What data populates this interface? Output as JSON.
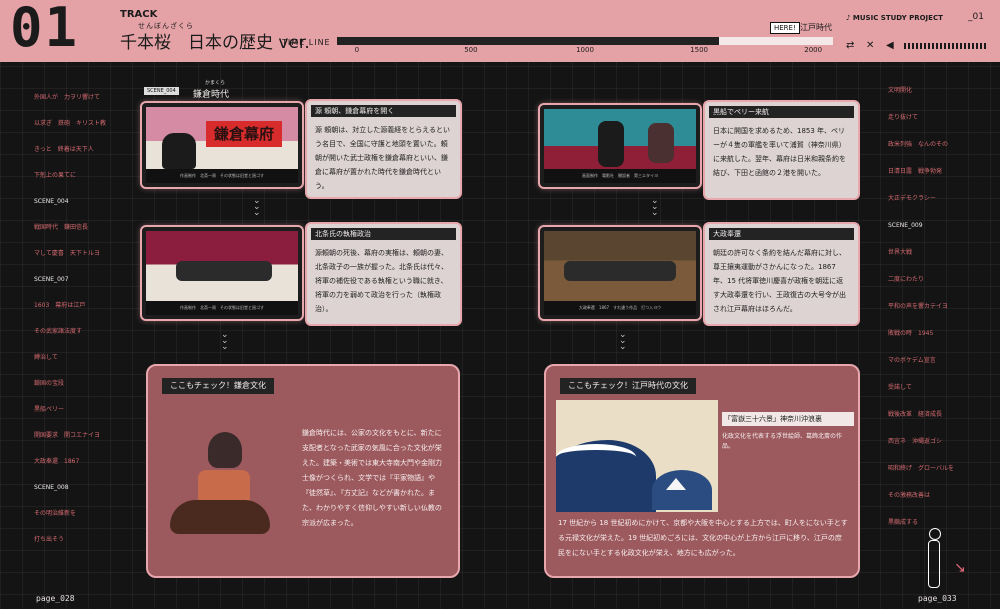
{
  "header": {
    "track_number": "01",
    "track_label": "TRACK",
    "song_ruby": "せんぼんざくら",
    "song_title": "千本桜　日本の歴史 ver.",
    "timeline_label": "TIME LINE",
    "timeline_ticks": [
      "0",
      "500",
      "1000",
      "1500",
      "2000"
    ],
    "timeline_progress": 0.77,
    "here_label": "HERE!",
    "current_era": "江戸時代",
    "project": "MUSIC STUDY PROJECT",
    "page_code": "_01"
  },
  "left_list": [
    "外国人が　力ヲリ響けて",
    "以求ぎ　鉄砲　キリスト教",
    "きっと　終着は天下人",
    "下剋上の果てに",
    "SCENE_004",
    "戦国時代　鎌田信長",
    "マして慶喜　天下トルヨ",
    "SCENE_007",
    "1603　幕府は江戸",
    "その武家諸法度す",
    "縛治して",
    "鎖国の宝段",
    "黒船ペリー",
    "開国要求　開コエナイヨ",
    "大政奉還　1867",
    "SCENE_008",
    "その明治維新を",
    "打ち出そう"
  ],
  "right_list": [
    "文明開化",
    "走り抜けて",
    "政米列強　なんのその",
    "日清日露　戦争勃発",
    "大正デモクラシー",
    "SCENE_009",
    "世界大戦",
    "二度にわたり",
    "平和の声を響カテイヨ",
    "敗戦の時　1945",
    "マのボケデム宣言",
    "受諾して",
    "戦後改革　経済成長",
    "西宜ネ　沖縄返ゴシ",
    "昭和終げ　グローバルを",
    "その激務改善は",
    "黒繭成する"
  ],
  "left": {
    "scene_tag": "SCENE_004",
    "scene_title": "鎌倉時代",
    "scene_ruby": "かまくら",
    "card1": {
      "thumb_text": "鎌倉幕府",
      "caption": "作画制作　北斎一周　その状態は旧堂と過ゴす",
      "heading": "源 頼朝、鎌倉幕府を開く",
      "text": "源 頼朝は、対立した源義経をとらえるという名目で、全国に守護と地頭を置いた。頼朝が開いた武士政権を鎌倉幕府といい、鎌倉に幕府が置かれた時代を鎌倉時代という。"
    },
    "card2": {
      "caption": "作画制作　北斎一周　その状態は旧堂と過ゴす",
      "heading": "北条氏の執権政治",
      "text": "源頼朝の死後、幕府の実権は、頼朝の妻、北条政子の一族が握った。北条氏は代々、将軍の補佐役である執権という職に就き、将軍の力を弱めて政治を行った（執権政治）。"
    },
    "big": {
      "heading": "ここもチェック！鎌倉文化",
      "text": "鎌倉時代には、公家の文化をもとに、新たに支配者となった武家の気風に合った文化が栄えた。建築・美術では東大寺南大門や金剛力士像がつくられ、文学では『平家物語』や『徒然草』、『方丈記』などが書かれた。また、わかりやすく信仰しやすい新しい仏教の宗派が広まった。"
    },
    "page": "page_028"
  },
  "right": {
    "card1": {
      "caption": "画面制作　電影社　開設者　第三エタイヨ",
      "heading": "黒船でペリー来航",
      "text": "日本に開国を求めるため、1853 年、ペリーが４隻の軍艦を率いて浦賀（神奈川県）に来航した。翌年、幕府は日米和親条約を結び、下田と函館の２港を開いた。"
    },
    "card2": {
      "caption": "大政奉還　1867　すれ違う作品　打つ入ヨウ",
      "heading": "大政奉還",
      "text": "朝廷の許可なく条約を結んだ幕府に対し、尊王攘夷運動がさかんになった。1867 年、15 代将軍徳川慶喜が政権を朝廷に返す大政奉還を行い、王政復古の大号令が出され江戸幕府はほろんだ。"
    },
    "big": {
      "heading": "ここもチェック！江戸時代の文化",
      "art_title": "「富嶽三十六景」神奈川沖浪裏",
      "art_caption": "化政文化を代表する浮世絵師、葛飾北斎の作品。",
      "text": "17 世紀から 18 世紀初めにかけて、京都や大阪を中心とする上方では、町人をにない手とする元禄文化が栄えた。19 世紀初めごろには、文化の中心が上方から江戸に移り、江戸の庶民をにない手とする化政文化が栄え、地方にも広がった。"
    },
    "page": "page_033"
  },
  "colors": {
    "accent": "#e4a2a6",
    "panel": "#9c5a5e",
    "highlight": "#c4002b"
  }
}
